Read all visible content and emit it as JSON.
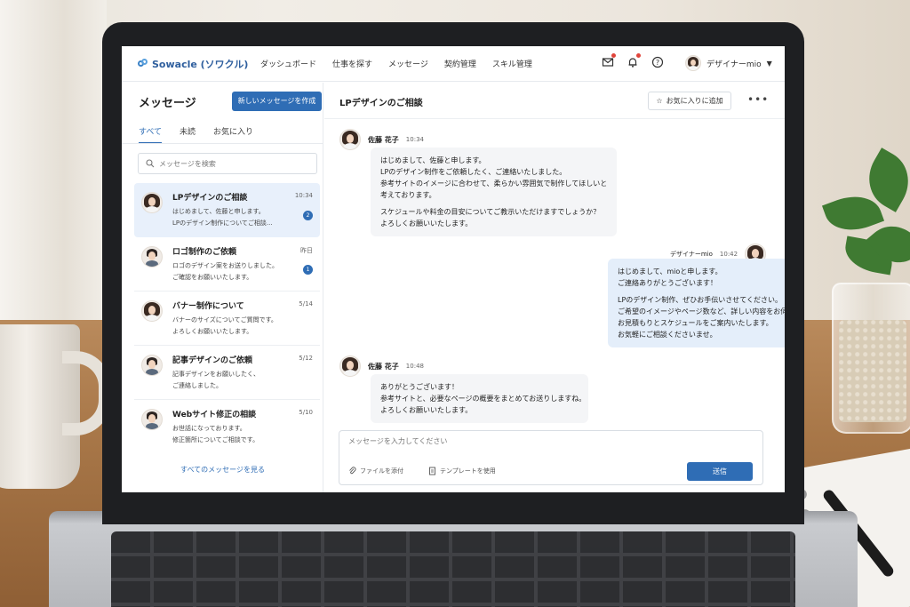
{
  "app": {
    "logo": "Sowacle (ソワクル)"
  },
  "nav": {
    "links": [
      "ダッシュボード",
      "仕事を探す",
      "メッセージ",
      "契約管理",
      "スキル管理"
    ],
    "user_name": "デザイナーmio"
  },
  "sidebar": {
    "title": "メッセージ",
    "new_button": "新しいメッセージを作成",
    "tabs": [
      "すべて",
      "未読",
      "お気に入り"
    ],
    "search_placeholder": "メッセージを検索",
    "conversations": [
      {
        "title": "LPデザインのご相談",
        "time": "10:34",
        "lines": [
          "はじめまして、佐藤と申します。",
          "LPのデザイン制作についてご相談..."
        ],
        "unread": "2"
      },
      {
        "title": "ロゴ制作のご依頼",
        "time": "昨日",
        "lines": [
          "ロゴのデザイン案をお送りしました。",
          "ご確認をお願いいたします。"
        ],
        "unread": "1"
      },
      {
        "title": "バナー制作について",
        "time": "5/14",
        "lines": [
          "バナーのサイズについてご質問です。",
          "よろしくお願いいたします。"
        ]
      },
      {
        "title": "記事デザインのご依頼",
        "time": "5/12",
        "lines": [
          "記事デザインをお願いしたく、",
          "ご連絡しました。"
        ]
      },
      {
        "title": "Webサイト修正の相談",
        "time": "5/10",
        "lines": [
          "お世話になっております。",
          "修正箇所についてご相談です。"
        ]
      }
    ],
    "see_all": "すべてのメッセージを見る"
  },
  "chat": {
    "title": "LPデザインのご相談",
    "favorite_button": "お気に入りに追加",
    "messages": [
      {
        "sender": "佐藤 花子",
        "time": "10:34",
        "lines": [
          "はじめまして、佐藤と申します。",
          "LPのデザイン制作をご依頼したく、ご連絡いたしました。",
          "参考サイトのイメージに合わせて、柔らかい雰囲気で制作してほしいと",
          "考えております。"
        ],
        "lines2": [
          "スケジュールや料金の目安についてご教示いただけますでしょうか？",
          "よろしくお願いいたします。"
        ]
      },
      {
        "sender": "デザイナーmio",
        "time": "10:42",
        "lines": [
          "はじめまして、mioと申します。",
          "ご連絡ありがとうございます！"
        ],
        "lines2": [
          "LPのデザイン制作、ぜひお手伝いさせてください。",
          "ご希望のイメージやページ数など、詳しい内容をお伺いできれば",
          "お見積もりとスケジュールをご案内いたします。",
          "お気軽にご相談くださいませ。"
        ]
      },
      {
        "sender": "佐藤 花子",
        "time": "10:48",
        "lines": [
          "ありがとうございます！",
          "参考サイトと、必要なページの概要をまとめてお送りしますね。",
          "よろしくお願いいたします。"
        ]
      }
    ],
    "composer_placeholder": "メッセージを入力してください",
    "attach_label": "ファイルを添付",
    "template_label": "テンプレートを使用",
    "send_label": "送信"
  },
  "colors": {
    "accent": "#2f6db5",
    "active_row": "#e8f0fb",
    "my_bubble": "#e4eefa",
    "other_bubble": "#f4f5f7",
    "notify_dot": "#e0443b"
  }
}
